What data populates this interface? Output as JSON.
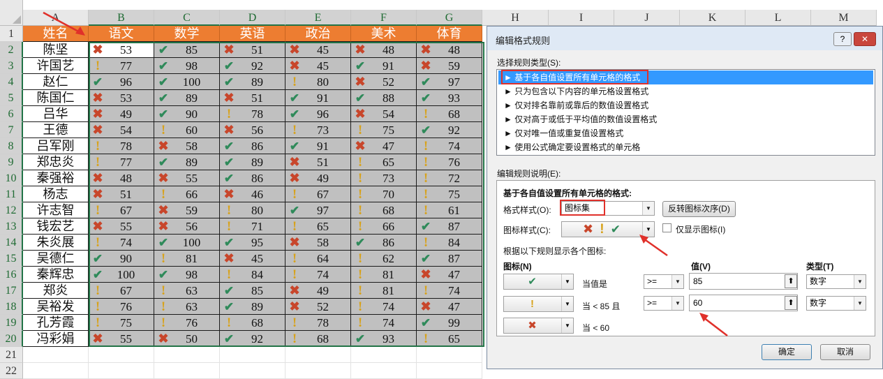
{
  "columns": [
    "A",
    "B",
    "C",
    "D",
    "E",
    "F",
    "G",
    "H",
    "I",
    "J",
    "K",
    "L",
    "M"
  ],
  "row_numbers": [
    "1",
    "2",
    "3",
    "4",
    "5",
    "6",
    "7",
    "8",
    "9",
    "10",
    "11",
    "12",
    "13",
    "14",
    "15",
    "16",
    "17",
    "18",
    "19",
    "20",
    "21",
    "22"
  ],
  "table": {
    "headers": [
      "姓名",
      "语文",
      "数学",
      "英语",
      "政治",
      "美术",
      "体育"
    ],
    "rows": [
      {
        "name": "陈坚",
        "scores": [
          53,
          85,
          51,
          45,
          48,
          48
        ]
      },
      {
        "name": "许国艺",
        "scores": [
          77,
          98,
          92,
          45,
          91,
          59
        ]
      },
      {
        "name": "赵仁",
        "scores": [
          96,
          100,
          89,
          80,
          52,
          97
        ]
      },
      {
        "name": "陈国仁",
        "scores": [
          53,
          89,
          51,
          91,
          88,
          93
        ]
      },
      {
        "name": "吕华",
        "scores": [
          49,
          90,
          78,
          96,
          54,
          68
        ]
      },
      {
        "name": "王德",
        "scores": [
          54,
          60,
          56,
          73,
          75,
          92
        ]
      },
      {
        "name": "吕军刚",
        "scores": [
          78,
          58,
          86,
          91,
          47,
          74
        ]
      },
      {
        "name": "郑忠炎",
        "scores": [
          77,
          89,
          89,
          51,
          65,
          76
        ]
      },
      {
        "name": "秦强裕",
        "scores": [
          48,
          55,
          86,
          49,
          73,
          72
        ]
      },
      {
        "name": "杨志",
        "scores": [
          51,
          66,
          46,
          67,
          70,
          75
        ]
      },
      {
        "name": "许志智",
        "scores": [
          67,
          59,
          80,
          97,
          68,
          61
        ]
      },
      {
        "name": "钱宏艺",
        "scores": [
          55,
          56,
          71,
          65,
          66,
          87
        ]
      },
      {
        "name": "朱炎展",
        "scores": [
          74,
          100,
          95,
          58,
          86,
          84
        ]
      },
      {
        "name": "吴德仁",
        "scores": [
          90,
          81,
          45,
          64,
          62,
          87
        ]
      },
      {
        "name": "秦辉忠",
        "scores": [
          100,
          98,
          84,
          74,
          81,
          47
        ]
      },
      {
        "name": "郑炎",
        "scores": [
          67,
          63,
          85,
          49,
          81,
          74
        ]
      },
      {
        "name": "吴裕发",
        "scores": [
          76,
          63,
          89,
          52,
          74,
          47
        ]
      },
      {
        "name": "孔芳霞",
        "scores": [
          75,
          76,
          68,
          78,
          74,
          99
        ]
      },
      {
        "name": "冯彩娟",
        "scores": [
          55,
          50,
          92,
          68,
          93,
          65
        ]
      }
    ]
  },
  "icons": {
    "check": "check-icon",
    "exclaim": "exclamation-icon",
    "cross": "cross-icon"
  },
  "colors": {
    "header_orange": "#ed7d31",
    "selection_green": "#217346",
    "check": "#2f8a5a",
    "cross": "#c8462b",
    "exclaim": "#d7a21b",
    "highlight_red": "#e0302a",
    "list_selected": "#3399ff"
  },
  "dialog": {
    "title": "编辑格式规则",
    "help_label": "?",
    "close_label": "✕",
    "rule_type_label": "选择规则类型(S):",
    "rule_types": [
      "► 基于各自值设置所有单元格的格式",
      "► 只为包含以下内容的单元格设置格式",
      "► 仅对排名靠前或靠后的数值设置格式",
      "► 仅对高于或低于平均值的数值设置格式",
      "► 仅对唯一值或重复值设置格式",
      "► 使用公式确定要设置格式的单元格"
    ],
    "edit_desc_label": "编辑规则说明(E):",
    "section_title": "基于各自值设置所有单元格的格式:",
    "format_style_label": "格式样式(O):",
    "format_style_value": "图标集",
    "reverse_button": "反转图标次序(D)",
    "icon_style_label": "图标样式(C):",
    "show_icon_only": "仅显示图标(I)",
    "rules_label": "根据以下规则显示各个图标:",
    "col_icon": "图标(N)",
    "col_value": "值(V)",
    "col_type": "类型(T)",
    "rule_rows": [
      {
        "icon": "check",
        "cond": "当值是",
        "op": ">=",
        "value": "85",
        "type": "数字"
      },
      {
        "icon": "exclaim",
        "cond": "当 < 85 且",
        "op": ">=",
        "value": "60",
        "type": "数字"
      },
      {
        "icon": "cross",
        "cond": "当 < 60",
        "op": "",
        "value": "",
        "type": ""
      }
    ],
    "ok_button": "确定",
    "cancel_button": "取消"
  }
}
